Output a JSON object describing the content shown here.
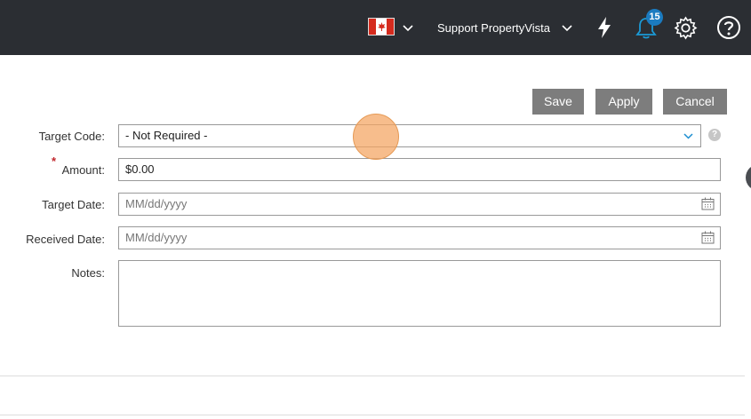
{
  "topbar": {
    "flag_icon": "canada-flag-icon",
    "account_label": "Support PropertyVista",
    "notification_count": "15",
    "icons": [
      "chevron-down-icon",
      "bolt-icon",
      "bell-icon",
      "gear-icon",
      "help-icon"
    ],
    "colors": {
      "bar": "#2b2e33",
      "badge": "#1b7bc0"
    }
  },
  "actions": {
    "save_label": "Save",
    "apply_label": "Apply",
    "cancel_label": "Cancel"
  },
  "form": {
    "target_code": {
      "label": "Target Code:",
      "value": "- Not Required -"
    },
    "amount": {
      "label": "Amount:",
      "required_mark": "*",
      "value": "$0.00"
    },
    "target_date": {
      "label": "Target Date:",
      "placeholder": "MM/dd/yyyy"
    },
    "received_date": {
      "label": "Received Date:",
      "placeholder": "MM/dd/yyyy"
    },
    "notes": {
      "label": "Notes:",
      "value": ""
    },
    "info_icon": "?"
  }
}
